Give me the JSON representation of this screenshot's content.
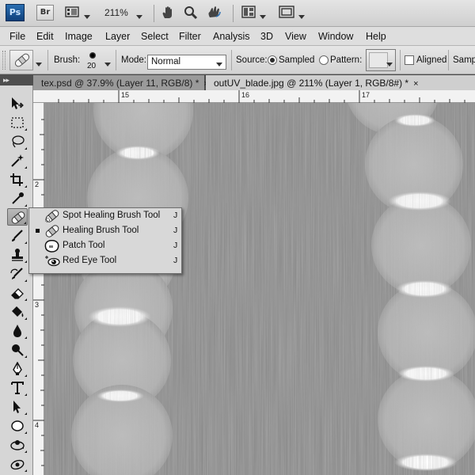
{
  "app": {
    "logo": "Ps",
    "bridge_label": "Br",
    "zoom": "211%"
  },
  "menu": [
    "File",
    "Edit",
    "Image",
    "Layer",
    "Select",
    "Filter",
    "Analysis",
    "3D",
    "View",
    "Window",
    "Help"
  ],
  "options": {
    "brush_label": "Brush:",
    "brush_size": "20",
    "mode_label": "Mode:",
    "mode_value": "Normal",
    "source_label": "Source:",
    "sampled_label": "Sampled",
    "pattern_label": "Pattern:",
    "aligned_label": "Aligned",
    "sample_label": "Sampl"
  },
  "tabs": [
    {
      "label": "tex.psd @ 37.9% (Layer 11, RGB/8) *",
      "close": "×"
    },
    {
      "label": "outUV_blade.jpg @ 211% (Layer 1, RGB/8#) *",
      "close": "×"
    }
  ],
  "ruler": {
    "h_labels": [
      "15",
      "16",
      "17"
    ],
    "v_labels": [
      "2",
      "3",
      "4"
    ]
  },
  "flyout": [
    {
      "label": "Spot Healing Brush Tool",
      "key": "J",
      "icon": "spot-healing-brush-icon",
      "selected": false
    },
    {
      "label": "Healing Brush Tool",
      "key": "J",
      "icon": "healing-brush-icon",
      "selected": true
    },
    {
      "label": "Patch Tool",
      "key": "J",
      "icon": "patch-icon",
      "selected": false
    },
    {
      "label": "Red Eye Tool",
      "key": "J",
      "icon": "red-eye-icon",
      "selected": false
    }
  ],
  "tools": [
    "move-icon",
    "marquee-icon",
    "lasso-icon",
    "magic-wand-icon",
    "crop-icon",
    "eyedropper-icon",
    "healing-brush-icon",
    "brush-icon",
    "clone-stamp-icon",
    "history-brush-icon",
    "eraser-icon",
    "paint-bucket-icon",
    "blur-icon",
    "dodge-icon",
    "pen-icon",
    "type-icon",
    "path-selection-icon",
    "ellipse-icon",
    "3d-rotate-icon",
    "3d-orbit-icon"
  ],
  "colors": {
    "canvas_base": "#8c8c8c",
    "ui_panel": "#d6d6d6",
    "tab_active": "#cfcfcf",
    "logo_blue": "#1d5a9c"
  }
}
